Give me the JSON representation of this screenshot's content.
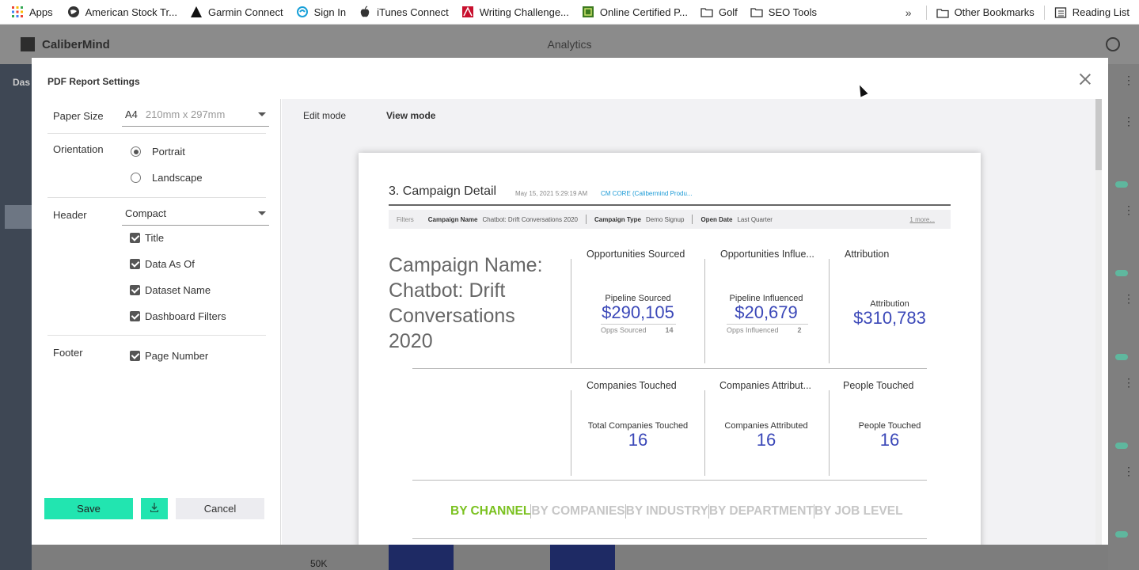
{
  "bookmarks": {
    "items": [
      {
        "label": "Apps",
        "icon": "apps-grid-icon"
      },
      {
        "label": "American Stock Tr...",
        "icon": "globe-icon"
      },
      {
        "label": "Garmin Connect",
        "icon": "garmin-triangle-icon"
      },
      {
        "label": "Sign In",
        "icon": "swirl-icon"
      },
      {
        "label": "iTunes Connect",
        "icon": "apple-icon"
      },
      {
        "label": "Writing Challenge...",
        "icon": "writing-icon"
      },
      {
        "label": "Online Certified P...",
        "icon": "certified-icon"
      },
      {
        "label": "Golf",
        "icon": "folder-icon"
      },
      {
        "label": "SEO Tools",
        "icon": "folder-icon"
      }
    ],
    "overflow": "»",
    "other": "Other Bookmarks",
    "reading_list": "Reading List"
  },
  "app": {
    "brand": "CaliberMind",
    "title": "Analytics",
    "left_label": "Das",
    "axis_tick": "50K"
  },
  "modal": {
    "title": "PDF Report Settings",
    "settings": {
      "paper_size_label": "Paper Size",
      "paper_size_value": "A4",
      "paper_size_dims": "210mm x 297mm",
      "orientation_label": "Orientation",
      "orientation_options": [
        "Portrait",
        "Landscape"
      ],
      "orientation_selected": "Portrait",
      "header_label": "Header",
      "header_value": "Compact",
      "header_options": [
        "Title",
        "Data As Of",
        "Dataset Name",
        "Dashboard Filters"
      ],
      "footer_label": "Footer",
      "footer_options": [
        "Page Number"
      ],
      "save_label": "Save",
      "cancel_label": "Cancel"
    },
    "preview": {
      "edit_mode": "Edit mode",
      "view_mode": "View mode",
      "page": {
        "title": "3. Campaign Detail",
        "date": "May 15, 2021 5:29:19 AM",
        "dataset": "CM CORE (Calibermind Produ...",
        "filters_label": "Filters",
        "filters": [
          {
            "name": "Campaign Name",
            "value": "Chatbot: Drift Conversations 2020"
          },
          {
            "name": "Campaign Type",
            "value": "Demo Signup"
          },
          {
            "name": "Open Date",
            "value": "Last Quarter"
          }
        ],
        "more": "1 more...",
        "campaign_name": "Campaign Name: Chatbot: Drift Conversations 2020",
        "kpis": [
          {
            "heading": "Opportunities Sourced",
            "label": "Pipeline Sourced",
            "value": "$290,105",
            "sub_label": "Opps Sourced",
            "sub_value": "14"
          },
          {
            "heading": "Opportunities Influe...",
            "label": "Pipeline Influenced",
            "value": "$20,679",
            "sub_label": "Opps Influenced",
            "sub_value": "2"
          },
          {
            "heading": "Attribution",
            "label": "Attribution",
            "value": "$310,783"
          },
          {
            "heading": "Companies Touched",
            "label": "Total Companies Touched",
            "value": "16"
          },
          {
            "heading": "Companies Attribut...",
            "label": "Companies Attributed",
            "value": "16"
          },
          {
            "heading": "People Touched",
            "label": "People Touched",
            "value": "16"
          }
        ],
        "channel_tabs": [
          "BY CHANNEL",
          "BY COMPANIES",
          "BY INDUSTRY",
          "BY DEPARTMENT",
          "BY JOB LEVEL"
        ],
        "active_tab": "BY CHANNEL"
      }
    }
  }
}
